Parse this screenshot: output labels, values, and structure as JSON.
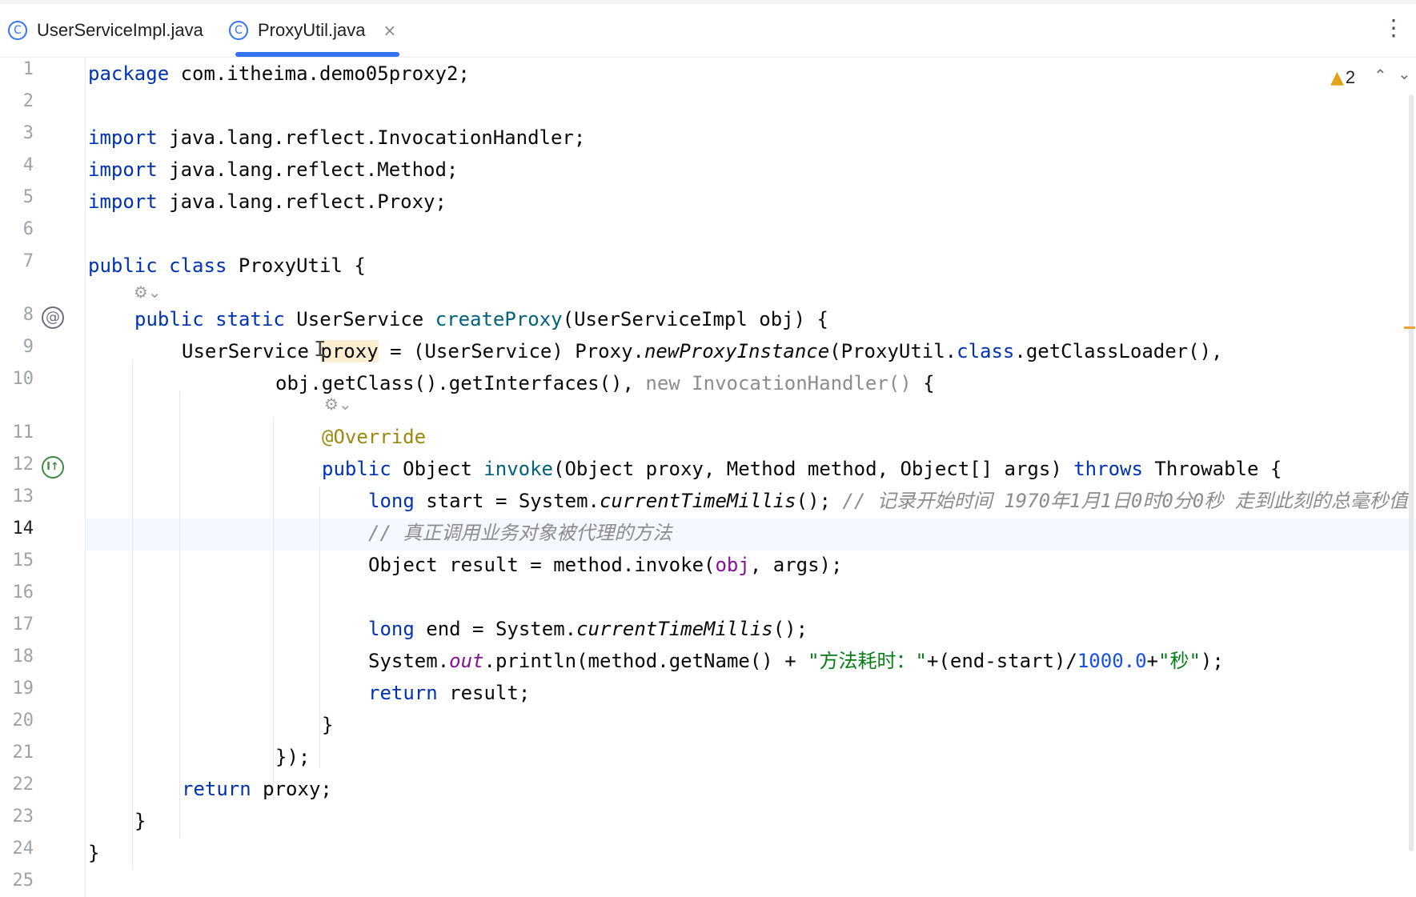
{
  "tabs": [
    {
      "label": "UserServiceImpl.java",
      "icon": "class-icon",
      "active": false
    },
    {
      "label": "ProxyUtil.java",
      "icon": "class-icon",
      "active": true,
      "close": "×"
    }
  ],
  "tab_icon_glyph": "C",
  "menu_glyph": "⋮",
  "inspections": {
    "icon": "warning-icon",
    "glyph": "▲",
    "count": "2",
    "prev": "⌃",
    "next": "⌄"
  },
  "current_line": "14",
  "gutter_icons": {
    "at": "@",
    "impl": "I↑"
  },
  "inlay_glyph": "⚙⌄",
  "line_numbers": [
    "1",
    "2",
    "3",
    "4",
    "5",
    "6",
    "7",
    "8",
    "9",
    "10",
    "11",
    "12",
    "13",
    "14",
    "15",
    "16",
    "17",
    "18",
    "19",
    "20",
    "21",
    "22",
    "23",
    "24",
    "25"
  ],
  "code": {
    "l1": {
      "a": "package",
      "b": " com.itheima.demo05proxy2;"
    },
    "l3": {
      "a": "import",
      "b": " java.lang.reflect.InvocationHandler;"
    },
    "l4": {
      "a": "import",
      "b": " java.lang.reflect.Method;"
    },
    "l5": {
      "a": "import",
      "b": " java.lang.reflect.Proxy;"
    },
    "l7": {
      "a": "public class",
      "b": " ProxyUtil {"
    },
    "l8": {
      "a": "public static",
      "b": " UserService ",
      "c": "createProxy",
      "d": "(UserServiceImpl obj) {"
    },
    "l9": {
      "a": "UserService ",
      "b": "proxy",
      "c": " = (UserService) Proxy.",
      "d": "newProxyInstance",
      "e": "(ProxyUtil.",
      "f": "class",
      "g": ".getClassLoader(),"
    },
    "l10": {
      "a": "obj.getClass().getInterfaces(), ",
      "b": "new InvocationHandler()",
      "c": " {"
    },
    "l11": {
      "a": "@Override"
    },
    "l12": {
      "a": "public",
      "b": " Object ",
      "c": "invoke",
      "d": "(Object proxy, Method method, Object[] args) ",
      "e": "throws",
      "f": " Throwable {"
    },
    "l13": {
      "a": "long",
      "b": " start = System.",
      "c": "currentTimeMillis",
      "d": "(); ",
      "e": "// 记录开始时间 1970年1月1日0时0分0秒 走到此刻的总毫秒值"
    },
    "l14": {
      "a": "// 真正调用业务对象被代理的方法"
    },
    "l15": {
      "a": "Object result = method.invoke(",
      "b": "obj",
      "c": ", args);"
    },
    "l17": {
      "a": "long",
      "b": " end = System.",
      "c": "currentTimeMillis",
      "d": "();"
    },
    "l18": {
      "a": "System.",
      "b": "out",
      "c": ".println(method.getName() + ",
      "d": "\"方法耗时：\"",
      "e": "+(end-start)/",
      "f": "1000.0",
      "g": "+",
      "h": "\"秒\"",
      "i": ");"
    },
    "l19": {
      "a": "return",
      "b": " result;"
    },
    "l20": {
      "a": "}"
    },
    "l21": {
      "a": "});"
    },
    "l22": {
      "a": "return",
      "b": " proxy;"
    },
    "l23": {
      "a": "}"
    },
    "l24": {
      "a": "}"
    }
  }
}
